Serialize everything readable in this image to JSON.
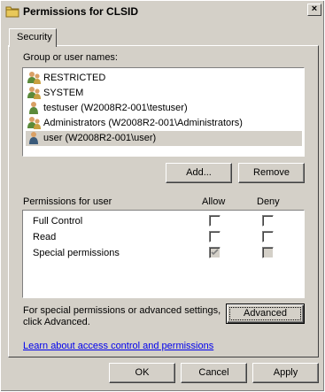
{
  "window": {
    "title": "Permissions for CLSID",
    "close_glyph": "×"
  },
  "tab": {
    "label": "Security"
  },
  "group_label": "Group or user names:",
  "users": [
    {
      "name": "RESTRICTED",
      "icon": "group-icon"
    },
    {
      "name": "SYSTEM",
      "icon": "group-icon"
    },
    {
      "name": "testuser (W2008R2-001\\testuser)",
      "icon": "user-icon"
    },
    {
      "name": "Administrators (W2008R2-001\\Administrators)",
      "icon": "group-icon"
    },
    {
      "name": "user (W2008R2-001\\user)",
      "icon": "user-icon",
      "selected": true
    }
  ],
  "buttons": {
    "add": "Add...",
    "remove": "Remove",
    "advanced": "Advanced",
    "ok": "OK",
    "cancel": "Cancel",
    "apply": "Apply"
  },
  "permissions": {
    "label": "Permissions for user",
    "allow_header": "Allow",
    "deny_header": "Deny",
    "rows": [
      {
        "name": "Full Control",
        "allow": false,
        "deny": false,
        "allow_disabled": false,
        "deny_disabled": false
      },
      {
        "name": "Read",
        "allow": false,
        "deny": false,
        "allow_disabled": false,
        "deny_disabled": false
      },
      {
        "name": "Special permissions",
        "allow": true,
        "deny": false,
        "allow_disabled": true,
        "deny_disabled": true
      }
    ]
  },
  "advanced_note": "For special permissions or advanced settings, click Advanced.",
  "help_link": "Learn about access control and permissions",
  "colors": {
    "face": "#d4d0c8",
    "link": "#0000ee",
    "selection": "#d4d0c8"
  }
}
